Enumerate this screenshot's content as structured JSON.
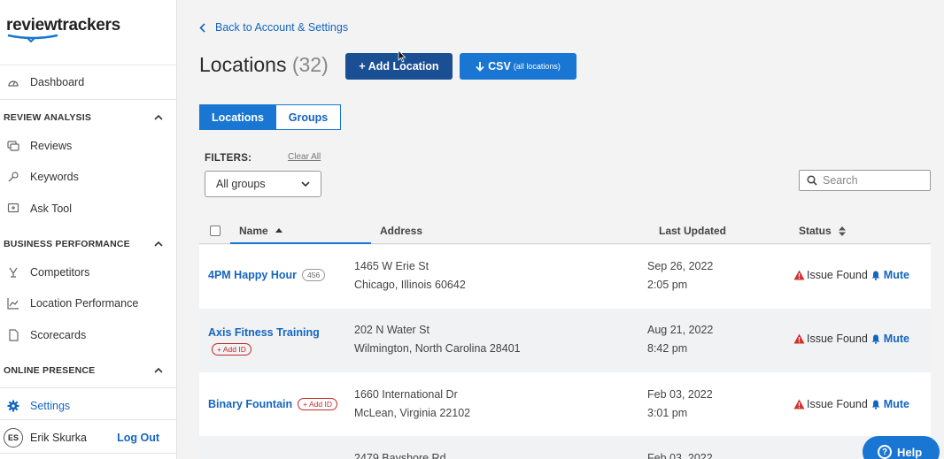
{
  "brand": {
    "logo_text": "reviewtrackers"
  },
  "sidebar": {
    "dashboard": "Dashboard",
    "sections": [
      {
        "label": "REVIEW ANALYSIS",
        "items": [
          "Reviews",
          "Keywords",
          "Ask Tool"
        ]
      },
      {
        "label": "BUSINESS PERFORMANCE",
        "items": [
          "Competitors",
          "Location Performance",
          "Scorecards"
        ]
      },
      {
        "label": "ONLINE PRESENCE",
        "items": [
          "Settings"
        ]
      }
    ],
    "active_item": "Settings",
    "user": {
      "initials": "ES",
      "name": "Erik Skurka",
      "logout": "Log Out"
    }
  },
  "header": {
    "back_link": "Back to Account & Settings",
    "title": "Locations",
    "count": "(32)",
    "add_button": "+ Add Location",
    "csv_button": "CSV",
    "csv_sub": "(all locations)"
  },
  "tabs": {
    "locations": "Locations",
    "groups": "Groups",
    "selected": "Locations"
  },
  "filters": {
    "label": "FILTERS:",
    "clear_all": "Clear All",
    "group_select": "All groups",
    "search_placeholder": "Search"
  },
  "table": {
    "columns": {
      "name": "Name",
      "address": "Address",
      "last_updated": "Last Updated",
      "status": "Status"
    },
    "rows": [
      {
        "name": "4PM Happy Hour",
        "badge": "456",
        "address1": "1465 W Erie St",
        "address2": "Chicago, Illinois 60642",
        "date": "Sep 26, 2022",
        "time": "2:05 pm",
        "status": "Issue Found",
        "action": "Mute"
      },
      {
        "name": "Axis Fitness Training",
        "badge": "+ Add ID",
        "address1": "202 N Water St",
        "address2": "Wilmington, North Carolina 28401",
        "date": "Aug 21, 2022",
        "time": "8:42 pm",
        "status": "Issue Found",
        "action": "Mute"
      },
      {
        "name": "Binary Fountain",
        "badge": "+ Add ID",
        "address1": "1660 International Dr",
        "address2": "McLean, Virginia 22102",
        "date": "Feb 03, 2022",
        "time": "3:01 pm",
        "status": "Issue Found",
        "action": "Mute"
      },
      {
        "address1": "2479 Bayshore Rd",
        "date": "Feb 03, 2022"
      }
    ]
  },
  "help_button": "Help",
  "colors": {
    "primary": "#1976d2",
    "primary_dark": "#1b4f93",
    "warning": "#d32f2f"
  }
}
